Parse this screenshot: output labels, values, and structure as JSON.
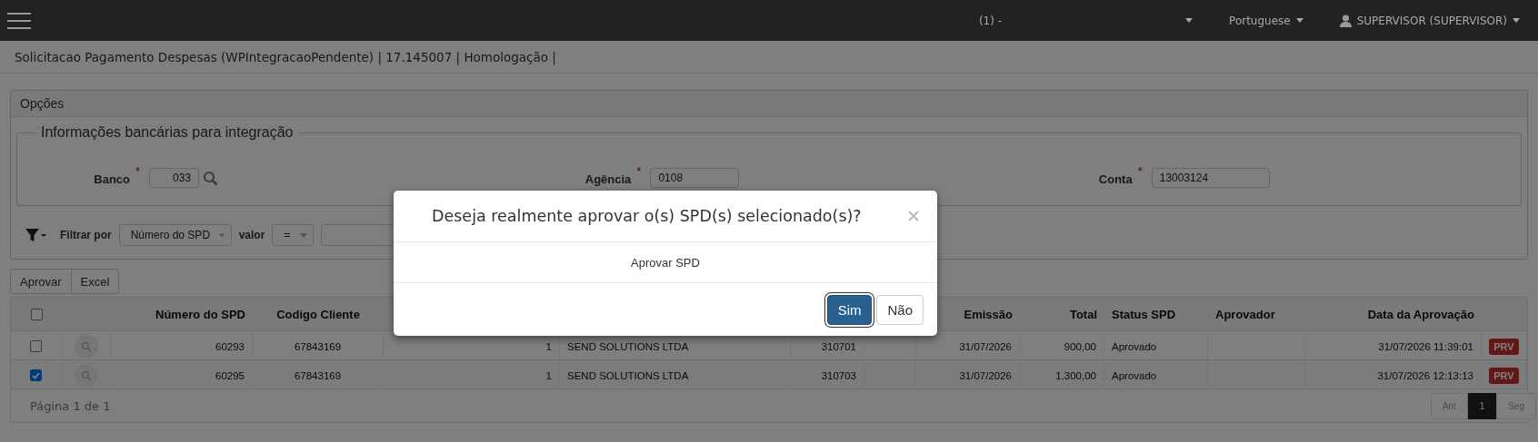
{
  "navbar": {
    "account": "(1) -",
    "language": "Portuguese",
    "user": "SUPERVISOR (SUPERVISOR)"
  },
  "page_title": "Solicitacao Pagamento Despesas (WPIntegracaoPendente) | 17.145007 | Homologação |",
  "options_panel": {
    "title": "Opções",
    "fieldset_legend": "Informações bancárias para integração",
    "fields": [
      {
        "label": "Banco",
        "value": "033",
        "required_mark": "*",
        "lookup": true
      },
      {
        "label": "Agência",
        "value": "0108",
        "required_mark": "*"
      },
      {
        "label": "Conta",
        "value": "13003124",
        "required_mark": "*"
      }
    ],
    "filter": {
      "label": "Filtrar por",
      "field": "Número do SPD",
      "value_label": "valor",
      "operator": "="
    }
  },
  "toolbar": [
    "Aprovar",
    "Excel"
  ],
  "table": {
    "all_selected": false,
    "columns": {
      "spd": "Número do SPD",
      "cliente": "Codigo Cliente",
      "emissao": "Emissão",
      "total": "Total",
      "status": "Status SPD",
      "aprovador": "Aprovador",
      "data_aprovacao": "Data da Aprovação"
    },
    "rows": [
      {
        "selected": false,
        "spd": "60293",
        "cliente": "67843169",
        "column_3": "1",
        "column_4": "SEND SOLUTIONS LTDA",
        "column_5": "310701",
        "emissao": "31/07/2026",
        "total": "900,00",
        "status": "Aprovado",
        "data_aprovacao": "31/07/2026 11:39:01",
        "badge": "PRV"
      },
      {
        "selected": true,
        "spd": "60295",
        "cliente": "67843169",
        "column_3": "1",
        "column_4": "SEND SOLUTIONS LTDA",
        "column_5": "310703",
        "emissao": "31/07/2026",
        "total": "1.300,00",
        "status": "Aprovado",
        "data_aprovacao": "31/07/2026 12:13:13",
        "badge": "PRV"
      }
    ],
    "page_info": "Página 1 de 1",
    "pagination": [
      {
        "label": "Ant",
        "selected": false
      },
      {
        "label": "1",
        "selected": true
      },
      {
        "label": "Seg",
        "selected": false
      }
    ]
  },
  "dialog": {
    "title": "Deseja realmente aprovar o(s) SPD(s) selecionado(s)?",
    "body": "Aprovar SPD",
    "buttons": [
      {
        "label": "Sim",
        "kind": "primary"
      },
      {
        "label": "Não",
        "kind": "default"
      }
    ]
  }
}
